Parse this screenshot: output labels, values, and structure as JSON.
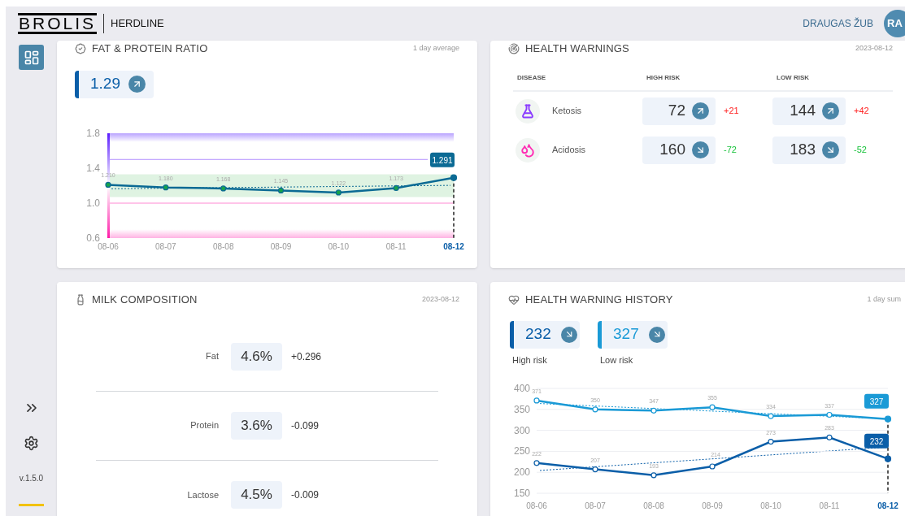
{
  "header": {
    "logo": "BROLIS",
    "product": "HERDLINE",
    "user": "DRAUGAS ŽUB",
    "avatar": "RA"
  },
  "sidebar": {
    "nav": [
      {
        "selected": true
      }
    ],
    "version": "v.1.5.0"
  },
  "fat_protein": {
    "title": "FAT & PROTEIN RATIO",
    "note": "1 day average",
    "kpi": {
      "value": "1.29",
      "rising": true
    },
    "chart_data": {
      "type": "line",
      "categories": [
        "08-06",
        "08-07",
        "08-08",
        "08-09",
        "08-10",
        "08-11",
        "08-12"
      ],
      "series": [
        {
          "color": "#0b6a94",
          "marker": true,
          "values": [
            1.21,
            1.18,
            1.168,
            1.145,
            1.122,
            1.173,
            1.291
          ],
          "value_labels": [
            "1.210",
            "1.180",
            "1.168",
            "1.145",
            "1.122",
            "1.173",
            "1.291"
          ]
        }
      ],
      "ylim": [
        0.6,
        1.8
      ],
      "yticks": [
        {
          "value": 0.6,
          "label": "0.6"
        },
        {
          "value": 1.0,
          "label": "1.0"
        },
        {
          "value": 1.4,
          "label": "1.4"
        },
        {
          "value": 1.8,
          "label": "1.8"
        }
      ]
    }
  },
  "health_warnings": {
    "title": "HEALTH WARNINGS",
    "date": "2023-08-12",
    "columns": [
      "DISEASE",
      "HIGH RISK",
      "LOW RISK"
    ],
    "rows": [
      {
        "name": "Ketosis",
        "color": "#8b3dff",
        "high": {
          "value": "72",
          "rising": true,
          "delta": "+21"
        },
        "low": {
          "value": "144",
          "rising": true,
          "delta": "+42"
        }
      },
      {
        "name": "Acidosis",
        "color": "#ff2db4",
        "high": {
          "value": "160",
          "rising": false,
          "delta": "-72"
        },
        "low": {
          "value": "183",
          "rising": false,
          "delta": "-52"
        }
      }
    ]
  },
  "milk_composition": {
    "title": "MILK COMPOSITION",
    "date": "2023-08-12",
    "rows": [
      {
        "label": "Fat",
        "value": "4.6%",
        "delta": "+0.296"
      },
      {
        "label": "Protein",
        "value": "3.6%",
        "delta": "-0.099"
      },
      {
        "label": "Lactose",
        "value": "4.5%",
        "delta": "-0.009"
      }
    ]
  },
  "health_warning_history": {
    "title": "HEALTH WARNING HISTORY",
    "note": "1 day sum",
    "kpis": [
      {
        "value": "232",
        "rising": false,
        "label": "High risk",
        "color": "#0a5ea8"
      },
      {
        "value": "327",
        "rising": false,
        "label": "Low risk",
        "color": "#1a9ad6"
      }
    ],
    "chart_data": {
      "type": "line",
      "categories": [
        "08-06",
        "08-07",
        "08-08",
        "08-09",
        "08-10",
        "08-11",
        "08-12"
      ],
      "series": [
        {
          "color": "#1a9ad6",
          "marker": true,
          "values": [
            371,
            350,
            347,
            355,
            334,
            337,
            327
          ],
          "value_labels": [
            "371",
            "350",
            "347",
            "355",
            "334",
            "337",
            "327"
          ]
        },
        {
          "color": "#0a5ea8",
          "marker": true,
          "values": [
            222,
            207,
            193,
            214,
            273,
            283,
            232
          ],
          "value_labels": [
            "222",
            "207",
            "193",
            "214",
            "273",
            "283",
            "232"
          ]
        }
      ],
      "grid": true,
      "ylim": [
        150,
        400
      ],
      "yticks": [
        150,
        200,
        250,
        300,
        350,
        400
      ]
    }
  }
}
